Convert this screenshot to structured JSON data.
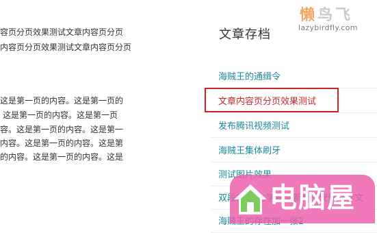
{
  "article": {
    "top_lines": [
      "容页分页效果测试文章内容页分页",
      "内容页分页效果测试文章内容页分页"
    ],
    "body_lines": [
      "这是第一页的内容。这是第一页的",
      "。这是第一页的内容。这是第一页",
      "容。这是第一页的内容。这是第一",
      "内容。这是第一页的内容。这是第",
      "的内容。这是第一页的内容。这是"
    ]
  },
  "logo": {
    "main_text_first": "懒",
    "main_text_rest": "鸟飞",
    "url_text": "lazybirdfly.com"
  },
  "sidebar": {
    "title": "文章存档",
    "items": [
      {
        "label": "海贼王的通缉令"
      },
      {
        "label": "文章内容页分页效果测试",
        "active": true
      },
      {
        "label": "发布腾讯视频测试"
      },
      {
        "label": "海贼王集体刷牙"
      },
      {
        "label": "测试图片效果"
      },
      {
        "label": "双段蝶:中生学友文新科王安保然作文"
      },
      {
        "label": "海贼王的存在加一张2"
      }
    ]
  },
  "watermark": {
    "text": "电脑屋"
  },
  "colors": {
    "link": "#1a8a9b",
    "active_link": "#c8262b",
    "highlight_border": "#cc2222",
    "watermark_pink": "#ec5caa"
  }
}
